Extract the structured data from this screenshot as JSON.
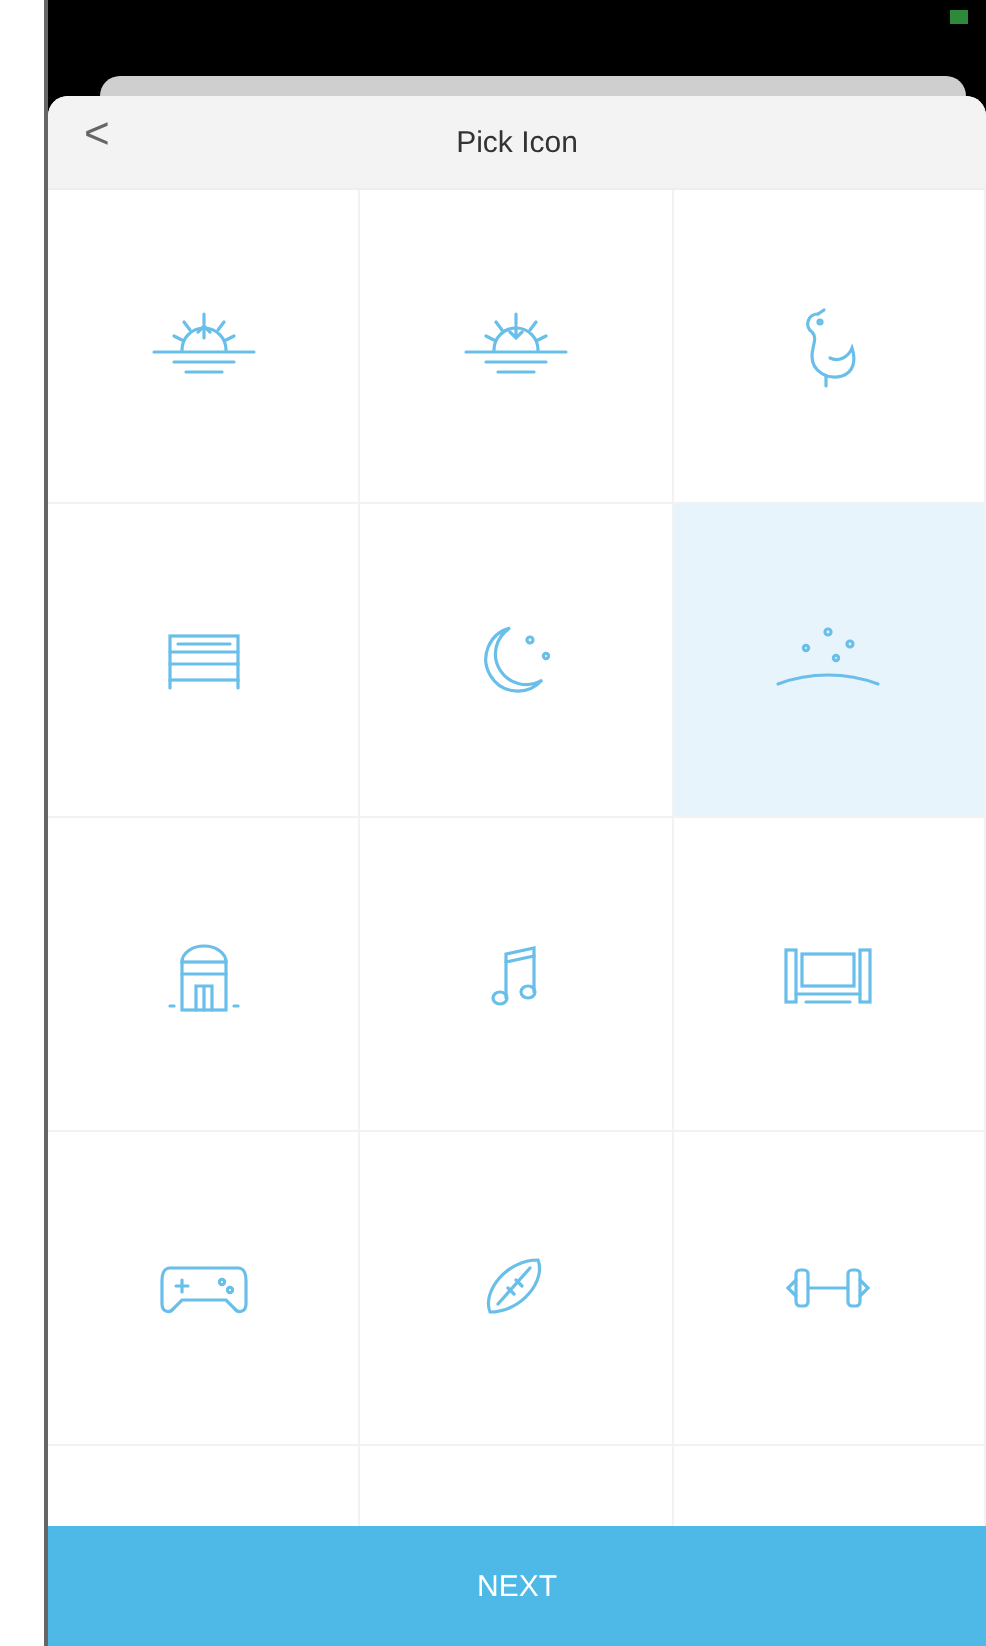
{
  "header": {
    "back": "<",
    "title": "Pick Icon"
  },
  "icons": [
    {
      "kind": "sunrise",
      "selected": false
    },
    {
      "kind": "sunset",
      "selected": false
    },
    {
      "kind": "rooster",
      "selected": false
    },
    {
      "kind": "bed",
      "selected": false
    },
    {
      "kind": "moon",
      "selected": false
    },
    {
      "kind": "stars",
      "selected": true
    },
    {
      "kind": "house",
      "selected": false
    },
    {
      "kind": "music",
      "selected": false
    },
    {
      "kind": "tv",
      "selected": false
    },
    {
      "kind": "gamepad",
      "selected": false
    },
    {
      "kind": "football",
      "selected": false
    },
    {
      "kind": "dumbbell",
      "selected": false
    }
  ],
  "button": "NEXT"
}
